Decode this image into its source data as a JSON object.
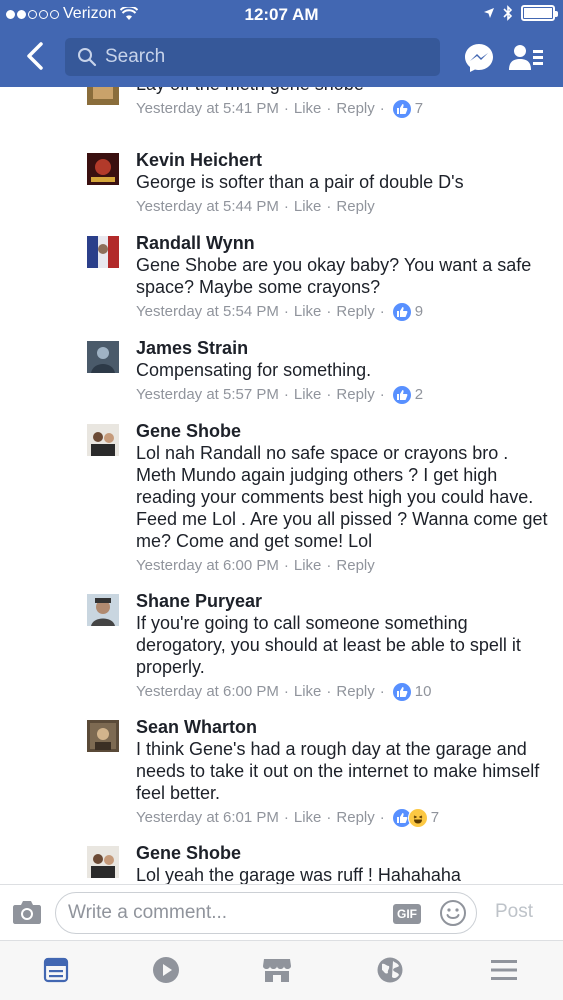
{
  "status_bar": {
    "carrier": "Verizon",
    "time": "12:07 AM"
  },
  "nav": {
    "search_placeholder": "Search"
  },
  "comments": [
    {
      "author": "",
      "text": "Lay off the meth gene shobe",
      "time": "Yesterday at 5:41 PM",
      "like": "Like",
      "reply": "Reply",
      "reactions": [
        "like"
      ],
      "reaction_count": "7"
    },
    {
      "author": "Kevin Heichert",
      "text": "George is softer than a pair of double D's",
      "time": "Yesterday at 5:44 PM",
      "like": "Like",
      "reply": "Reply",
      "reactions": [],
      "reaction_count": ""
    },
    {
      "author": "Randall Wynn",
      "text": "Gene Shobe are you okay baby? You want a safe space? Maybe some crayons?",
      "time": "Yesterday at 5:54 PM",
      "like": "Like",
      "reply": "Reply",
      "reactions": [
        "like"
      ],
      "reaction_count": "9"
    },
    {
      "author": "James Strain",
      "text": "Compensating for something.",
      "time": "Yesterday at 5:57 PM",
      "like": "Like",
      "reply": "Reply",
      "reactions": [
        "like"
      ],
      "reaction_count": "2"
    },
    {
      "author": "Gene Shobe",
      "text": "Lol nah Randall no safe space or crayons bro . Meth Mundo again judging others ? I get high reading your comments best high you could have. Feed me Lol . Are you all pissed ? Wanna come get me? Come and get some! Lol",
      "time": "Yesterday at 6:00 PM",
      "like": "Like",
      "reply": "Reply",
      "reactions": [],
      "reaction_count": ""
    },
    {
      "author": "Shane Puryear",
      "text": "If you're going to call someone something derogatory, you should at least be able to spell it properly.",
      "time": "Yesterday at 6:00 PM",
      "like": "Like",
      "reply": "Reply",
      "reactions": [
        "like"
      ],
      "reaction_count": "10"
    },
    {
      "author": "Sean Wharton",
      "text": "I think Gene's had a rough day at the garage and needs to take it out on the internet to make himself feel better.",
      "time": "Yesterday at 6:01 PM",
      "like": "Like",
      "reply": "Reply",
      "reactions": [
        "like",
        "haha"
      ],
      "reaction_count": "7"
    },
    {
      "author": "Gene Shobe",
      "text": "Lol yeah the garage was ruff ! Hahahaha",
      "time": "",
      "like": "",
      "reply": "",
      "reactions": [],
      "reaction_count": ""
    }
  ],
  "composer": {
    "placeholder": "Write a comment...",
    "gif_label": "GIF",
    "post_label": "Post"
  },
  "tabs": [
    "news-feed-icon",
    "video-icon",
    "marketplace-icon",
    "notifications-globe-icon",
    "menu-icon"
  ],
  "colors": {
    "brand": "#4267b2",
    "like": "#5890ff",
    "meta_text": "#90949c"
  }
}
